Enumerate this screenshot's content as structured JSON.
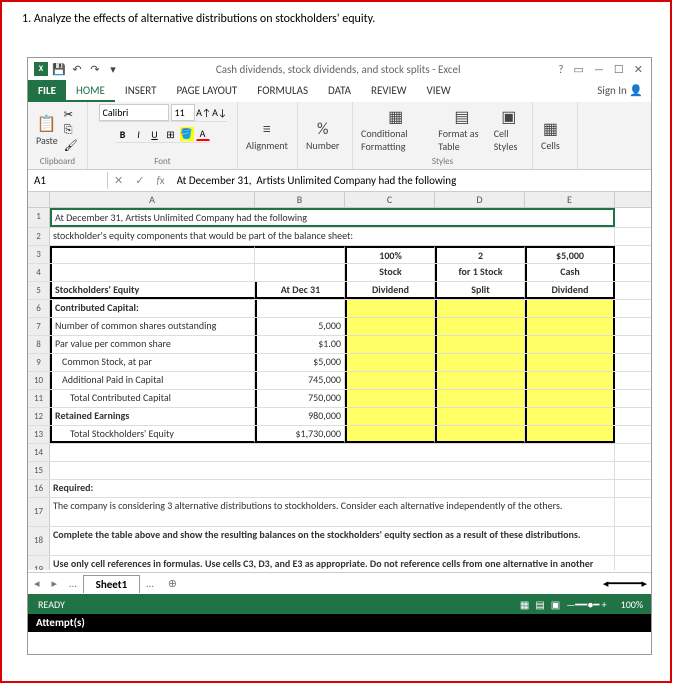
{
  "question": "1. Analyze the effects of alternative distributions on stockholders' equity.",
  "titlebar": {
    "title": "Cash dividends, stock dividends, and stock splits - Excel",
    "help": "?",
    "restore": "▭",
    "min": "—",
    "max": "☐",
    "close": "✕"
  },
  "tabs": {
    "file": "FILE",
    "home": "HOME",
    "insert": "INSERT",
    "pagelayout": "PAGE LAYOUT",
    "formulas": "FORMULAS",
    "data": "DATA",
    "review": "REVIEW",
    "view": "VIEW",
    "signin": "Sign In"
  },
  "ribbon": {
    "paste": "Paste",
    "clipboard": "Clipboard",
    "font_name": "Calibri",
    "font_size": "11",
    "font": "Font",
    "alignment": "Alignment",
    "number": "Number",
    "pct": "%",
    "condfmt": "Conditional Formatting",
    "fmttable": "Format as Table",
    "cellstyles": "Cell Styles",
    "styles": "Styles",
    "cells": "Cells"
  },
  "namebox": "A1",
  "formula": "At December 31,  Artists Unlimited Company had the following",
  "cols": {
    "A": "A",
    "B": "B",
    "C": "C",
    "D": "D",
    "E": "E"
  },
  "sheet": {
    "r1": "At December 31,  Artists Unlimited Company had the following",
    "r2": "stockholder's equity components that would be part of the balance sheet:",
    "hdr": {
      "c_top": "100%",
      "c_mid": "Stock",
      "c_bot": "Dividend",
      "d_top": "2",
      "d_mid": "for 1 Stock",
      "d_bot": "Split",
      "e_top": "$5,000",
      "e_mid": "Cash",
      "e_bot": "Dividend",
      "a5": "Stockholders' Equity",
      "b5": "At Dec 31"
    },
    "r6": "Contributed Capital:",
    "r7a": "Number of common shares outstanding",
    "r7b": "5,000",
    "r8a": "Par value per common share",
    "r8cur": "$",
    "r8b": "1.00",
    "r9a": "Common Stock, at par",
    "r9cur": "$",
    "r9b": "5,000",
    "r10a": "Additional Paid in Capital",
    "r10b": "745,000",
    "r11a": "Total Contributed Capital",
    "r11b": "750,000",
    "r12a": "Retained Earnings",
    "r12b": "980,000",
    "r13a": "Total Stockholders' Equity",
    "r13cur": "$",
    "r13b": "1,730,000",
    "r16": "Required:",
    "r17": "The company is considering 3 alternative distributions to stockholders.  Consider each alternative independently of the others.",
    "r18": "Complete the table above and show the resulting balances on the stockholders' equity section as a result of these distributions.",
    "r19": "Use only cell references in formulas.  Use cells C3, D3, and E3 as appropriate.  Do not reference cells from one alternative in another alternative."
  },
  "sheettab": "Sheet1",
  "status": {
    "ready": "READY",
    "zoom": "100%"
  },
  "attempts": "Attempt(s)"
}
